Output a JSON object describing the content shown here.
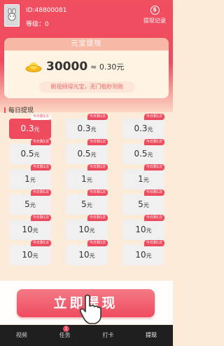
{
  "header": {
    "uid": "ID:48800081",
    "level": "等级：0",
    "record_label": "提现记录",
    "record_icon_glyph": "$"
  },
  "balance": {
    "title": "元宝提现",
    "coins": "30000",
    "approx": "≈ 0.30元",
    "hint": "刷视频得元宝，无门槛秒到账"
  },
  "daily": {
    "title": "每日提现",
    "tag": "今日剩1次",
    "options": [
      {
        "amount": "0.3",
        "unit": "元",
        "selected": true
      },
      {
        "amount": "0.3",
        "unit": "元",
        "selected": false
      },
      {
        "amount": "0.3",
        "unit": "元",
        "selected": false
      },
      {
        "amount": "0.5",
        "unit": "元",
        "selected": false
      },
      {
        "amount": "0.5",
        "unit": "元",
        "selected": false
      },
      {
        "amount": "0.5",
        "unit": "元",
        "selected": false
      },
      {
        "amount": "1",
        "unit": "元",
        "selected": false
      },
      {
        "amount": "1",
        "unit": "元",
        "selected": false
      },
      {
        "amount": "1",
        "unit": "元",
        "selected": false
      },
      {
        "amount": "5",
        "unit": "元",
        "selected": false
      },
      {
        "amount": "5",
        "unit": "元",
        "selected": false
      },
      {
        "amount": "5",
        "unit": "元",
        "selected": false
      },
      {
        "amount": "10",
        "unit": "元",
        "selected": false
      },
      {
        "amount": "10",
        "unit": "元",
        "selected": false
      },
      {
        "amount": "10",
        "unit": "元",
        "selected": false
      },
      {
        "amount": "10",
        "unit": "元",
        "selected": false
      },
      {
        "amount": "10",
        "unit": "元",
        "selected": false
      },
      {
        "amount": "10",
        "unit": "元",
        "selected": false
      }
    ]
  },
  "withdraw_button": "立即提现",
  "tabs": [
    {
      "label": "视频",
      "active": false
    },
    {
      "label": "任务",
      "active": false,
      "badge": "1"
    },
    {
      "label": "打卡",
      "active": false
    },
    {
      "label": "提现",
      "active": true
    }
  ],
  "colors": {
    "accent": "#ef4b5f",
    "background": "#fdebd9",
    "tabbar": "#1f1f1f"
  }
}
